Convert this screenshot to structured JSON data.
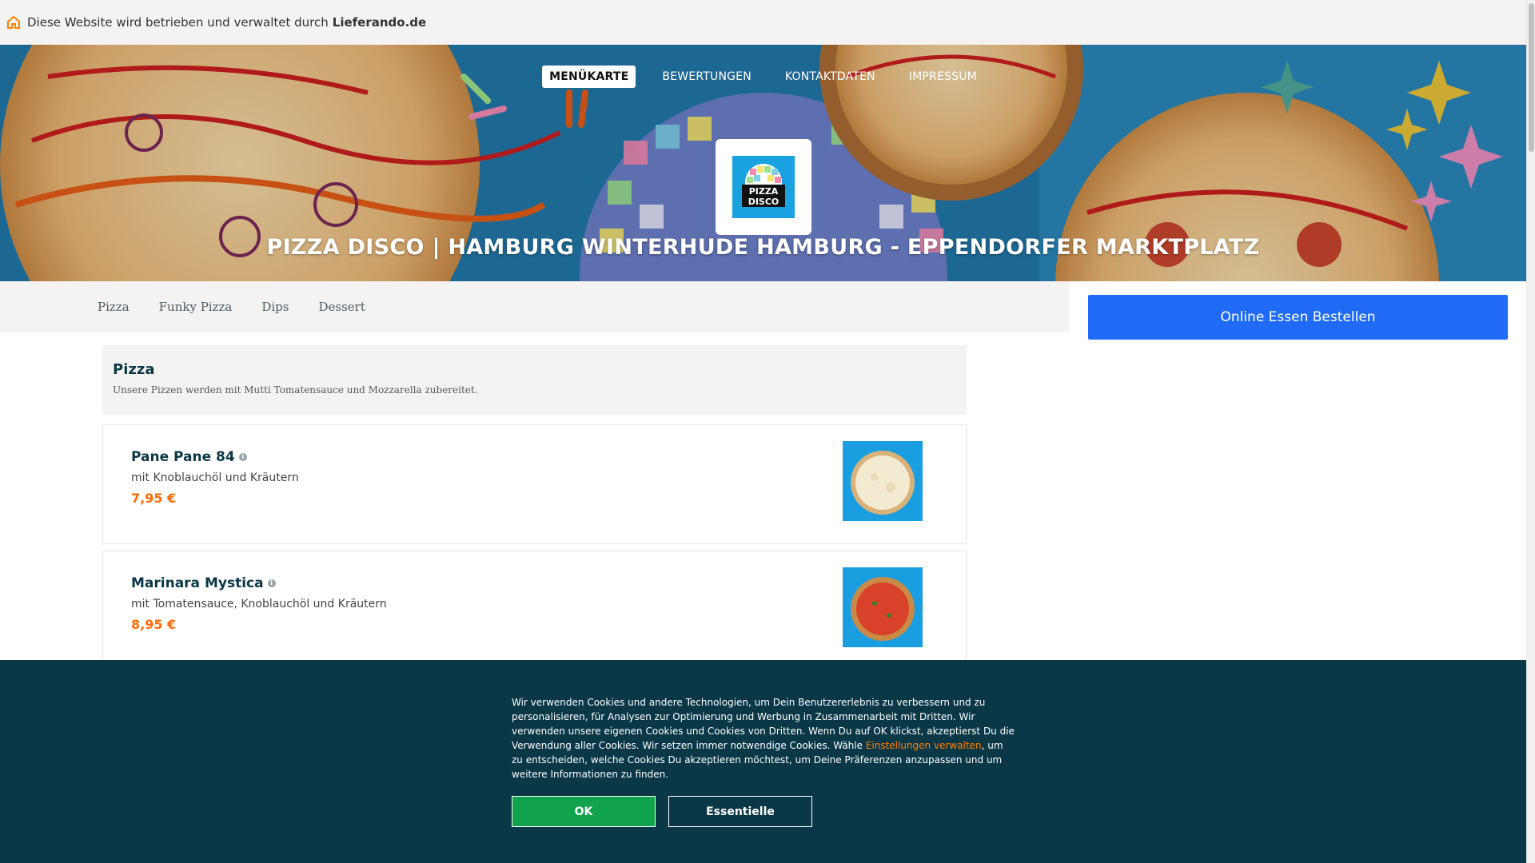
{
  "topbar": {
    "icon": "home-icon",
    "text": "Diese Website wird betrieben und verwaltet durch",
    "brand": "Lieferando.de"
  },
  "nav": {
    "items": [
      {
        "label": "MENÜKARTE",
        "active": true
      },
      {
        "label": "BEWERTUNGEN",
        "active": false
      },
      {
        "label": "KONTAKTDATEN",
        "active": false
      },
      {
        "label": "IMPRESSUM",
        "active": false
      }
    ]
  },
  "hero": {
    "title": "PIZZA DISCO | HAMBURG WINTERHUDE HAMBURG - EPPENDORFER MARKTPLATZ",
    "logo_text": [
      "PIZZA",
      "DISCO"
    ]
  },
  "categories": [
    "Pizza",
    "Funky Pizza",
    "Dips",
    "Dessert"
  ],
  "order_button": "Online Essen Bestellen",
  "section": {
    "title": "Pizza",
    "description": "Unsere Pizzen werden mit Mutti Tomatensauce und Mozzarella zubereitet."
  },
  "items": [
    {
      "name": "Pane Pane 84",
      "description": "mit Knoblauchöl und Kräutern",
      "price": "7,95 €"
    },
    {
      "name": "Marinara Mystica",
      "description": "mit Tomatensauce, Knoblauchöl und Kräutern",
      "price": "8,95 €"
    }
  ],
  "cookie": {
    "text_before": "Wir verwenden Cookies und andere Technologien, um Dein Benutzererlebnis zu verbessern und zu personalisieren, für Analysen zur Optimierung und Werbung in Zusammenarbeit mit Dritten. Wir verwenden unsere eigenen Cookies und Cookies von Dritten. Wenn Du auf OK klickst, akzeptierst Du die Verwendung aller Cookies. Wir setzen immer notwendige Cookies. Wähle ",
    "link": "Einstellungen verwalten",
    "text_after": ", um zu entscheiden, welche Cookies Du akzeptieren möchtest, um Deine Präferenzen anzupassen und um weitere Informationen zu finden.",
    "ok_label": "OK",
    "essential_label": "Essentielle"
  },
  "colors": {
    "accent_orange": "#ff6a00",
    "order_blue": "#1f6bf5",
    "cookie_bg": "#0a3847",
    "ok_green": "#10a24d"
  }
}
